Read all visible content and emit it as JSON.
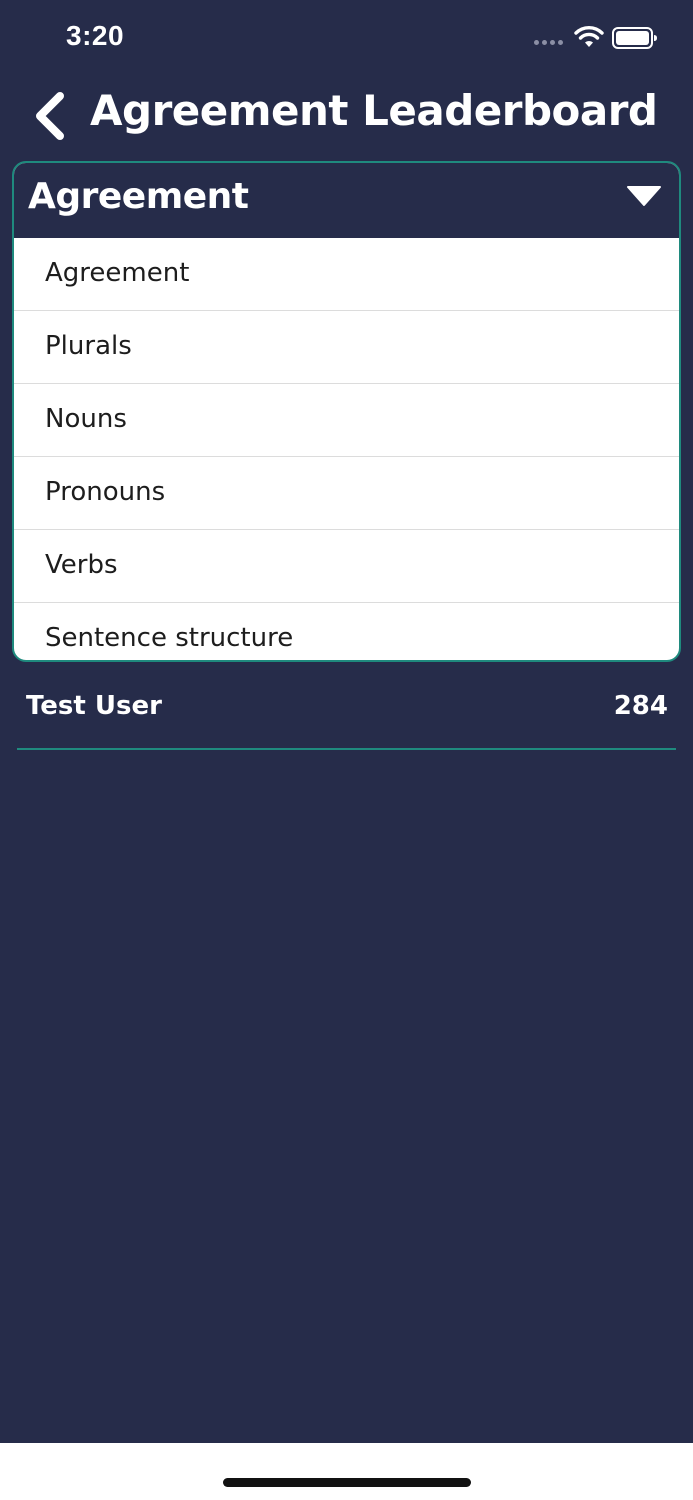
{
  "status_bar": {
    "time": "3:20",
    "icons": [
      "signal-dots-icon",
      "wifi-icon",
      "battery-icon"
    ]
  },
  "header": {
    "title": "Agreement Leaderboard",
    "back_icon": "chevron-left-icon"
  },
  "dropdown": {
    "selected": "Agreement",
    "caret_icon": "caret-down-icon",
    "options": [
      "Agreement",
      "Plurals",
      "Nouns",
      "Pronouns",
      "Verbs",
      "Sentence structure"
    ]
  },
  "leaderboard": {
    "rows": [
      {
        "name": "Test User",
        "score": "284"
      }
    ]
  },
  "colors": {
    "background": "#262c4a",
    "accent": "#1f8a7e",
    "text": "#ffffff"
  }
}
